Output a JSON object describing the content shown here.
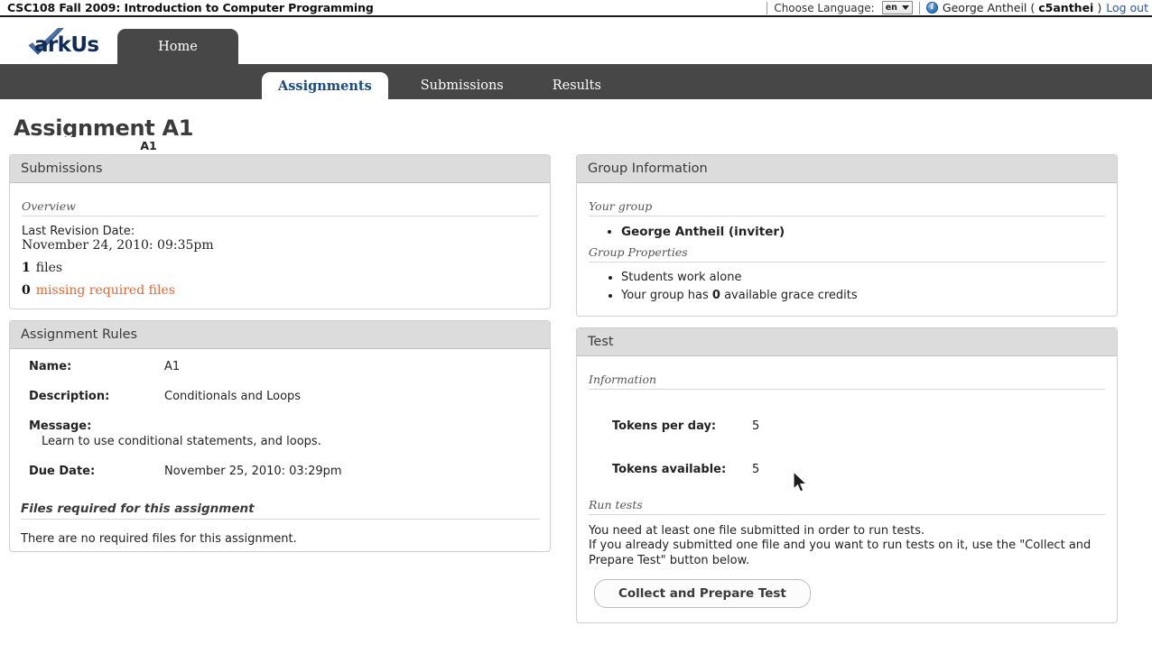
{
  "header": {
    "course_title": "CSC108 Fall 2009: Introduction to Computer Programming",
    "language_label": "Choose Language:",
    "language_value": "en",
    "info_icon": "info-icon",
    "user_name": "George Antheil",
    "open_paren": "(",
    "user_id": "c5anthei",
    "close_paren": ")",
    "logout_label": "Log out"
  },
  "branding": {
    "logo_text": "arkUs",
    "logo_check": "check-icon",
    "home_tab": "Home"
  },
  "nav": {
    "assignment_pill": "A1",
    "tabs": [
      {
        "label": "Assignments",
        "active": true
      },
      {
        "label": "Submissions",
        "active": false
      },
      {
        "label": "Results",
        "active": false
      }
    ]
  },
  "page": {
    "title": "Assignment A1"
  },
  "submissions": {
    "panel_title": "Submissions",
    "overview_label": "Overview",
    "last_revision_label": "Last Revision Date:",
    "last_revision_value": "November 24, 2010: 09:35pm",
    "files_count": "1",
    "files_word": "files",
    "missing_count": "0",
    "missing_link": "missing required files",
    "missing_link_color": "#e8652c"
  },
  "assignment_rules": {
    "panel_title": "Assignment Rules",
    "rows": [
      {
        "label": "Name:",
        "value": "A1"
      },
      {
        "label": "Description:",
        "value": "Conditionals and Loops"
      }
    ],
    "message_label": "Message:",
    "message_value": "Learn to use conditional statements, and loops.",
    "due_date_label": "Due Date:",
    "due_date_value": "November 25, 2010: 03:29pm",
    "files_heading": "Files required for this assignment",
    "files_note": "There are no required files for this assignment."
  },
  "group_information": {
    "panel_title": "Group Information",
    "your_group_label": "Your group",
    "members": [
      "George Antheil (inviter)"
    ],
    "group_properties_label": "Group Properties",
    "properties": [
      {
        "prefix": "Students work alone",
        "bold": "",
        "suffix": ""
      },
      {
        "prefix": "Your group has ",
        "bold": "0",
        "suffix": " available grace credits"
      }
    ]
  },
  "test": {
    "panel_title": "Test",
    "information_label": "Information",
    "tokens_per_day_label": "Tokens per day:",
    "tokens_per_day_value": "5",
    "tokens_available_label": "Tokens available:",
    "tokens_available_value": "5",
    "run_tests_label": "Run tests",
    "note_line1": "You need at least one file submitted in order to run tests.",
    "note_line2": "If you already submitted one file and you want to run tests on it, use the \"Collect and",
    "note_line3": "Prepare Test\" button below.",
    "collect_button": "Collect and Prepare Test"
  },
  "theme": {
    "nav_dark": "#474747",
    "panel_header_bg": "#dcdcdc",
    "link_blue": "#2a55a0",
    "logo_navy": "#0f2a54",
    "accent_orange": "#e8652c"
  }
}
